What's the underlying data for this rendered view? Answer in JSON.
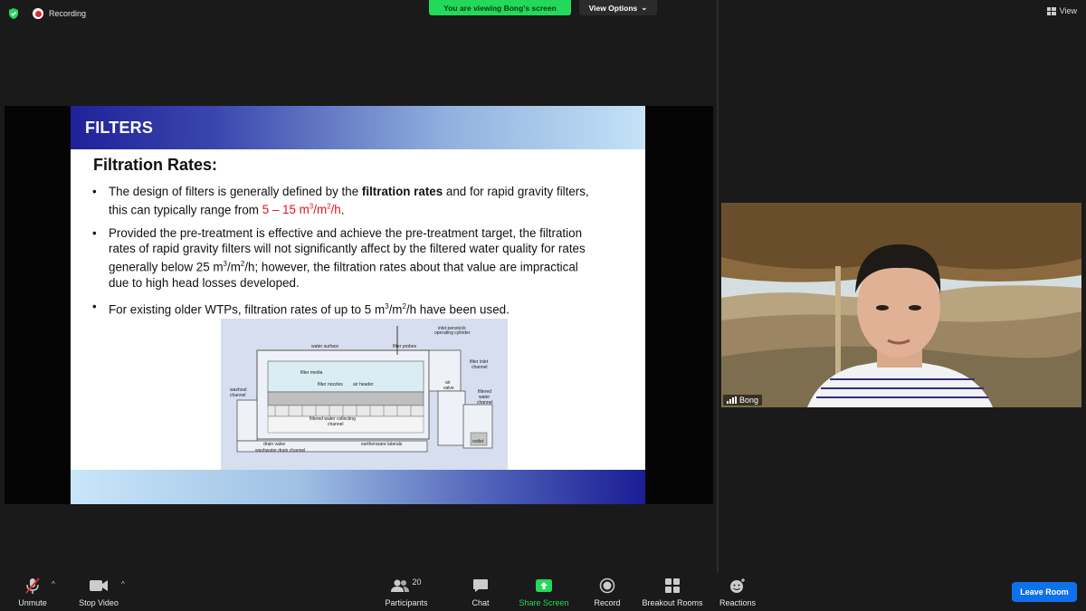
{
  "top": {
    "recording_label": "Recording",
    "viewing_banner": "You are viewing Bong's screen",
    "view_options_label": "View Options",
    "view_label": "View"
  },
  "slide": {
    "header": "FILTERS",
    "subtitle": "Filtration Rates:",
    "bullet1": {
      "a": "The design of filters is generally defined by the ",
      "bold": "filtration rates",
      "b": " and for rapid gravity filters, this can typically range from ",
      "red_pre": "5 – 15 m",
      "red_sup1": "3",
      "red_mid": "/m",
      "red_sup2": "2",
      "red_post": "/h",
      "c": "."
    },
    "bullet2": {
      "a": "Provided the pre-treatment is effective and achieve the pre-treatment target, the filtration rates of rapid gravity filters will not significantly affect by the filtered water quality for rates generally below 25 m",
      "sup1": "3",
      "mid": "/m",
      "sup2": "2",
      "b": "/h; however, the filtration rates about that value are impractical due to high head losses developed."
    },
    "bullet3": {
      "a": "For existing older WTPs, filtration rates of up to 5 m",
      "sup1": "3",
      "mid": "/m",
      "sup2": "2",
      "b": "/h have been used."
    },
    "diagram_labels": {
      "water_surface": "water surface",
      "filter_probes": "filter probes",
      "inlet_penstock": "inlet penstock",
      "operating_cylinder": "operating cylinder",
      "filter_inlet": "filter inlet",
      "channel": "channel",
      "filter_media": "filter media",
      "filter_nozzles": "filter nozzles",
      "air_header": "air header",
      "air": "air",
      "valve": "valve",
      "washout": "washout",
      "washout_channel": "channel",
      "filtered": "filtered",
      "filtered_water": "water",
      "filtered_channel": "channel",
      "collecting": "filtered water collecting",
      "collecting_channel": "channel",
      "drain_valve": "drain valve",
      "washwater": "washwater drain channel",
      "laterals": "earthenware laterals",
      "outlet": "outlet"
    }
  },
  "participant": {
    "name": "Bong"
  },
  "toolbar": {
    "unmute": "Unmute",
    "stop_video": "Stop Video",
    "participants": "Participants",
    "participants_count": "20",
    "chat": "Chat",
    "share_screen": "Share Screen",
    "record": "Record",
    "breakout_rooms": "Breakout Rooms",
    "reactions": "Reactions",
    "leave_room": "Leave Room"
  },
  "colors": {
    "banner_green": "#23d959",
    "leave_blue": "#0e71eb",
    "highlight_red": "#e0141b"
  }
}
